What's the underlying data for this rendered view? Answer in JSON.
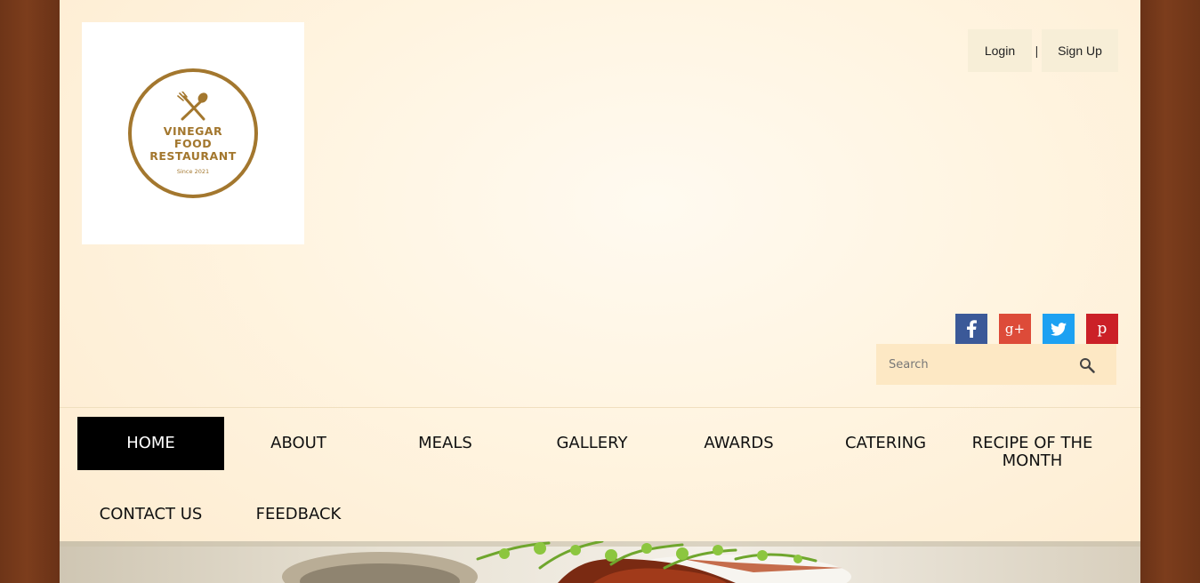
{
  "logo": {
    "line1": "VINEGAR",
    "line2": "FOOD",
    "line3": "RESTAURANT",
    "since": "Since 2021",
    "icon": "fork-spoon-icon",
    "color": "#a3772e"
  },
  "auth": {
    "login_label": "Login",
    "separator": "|",
    "signup_label": "Sign Up"
  },
  "social": [
    {
      "name": "facebook",
      "glyph": "f",
      "color": "#3b5998"
    },
    {
      "name": "google-plus",
      "glyph": "g+",
      "color": "#dd4b39"
    },
    {
      "name": "twitter",
      "glyph": "twitter-bird",
      "color": "#1da1f2"
    },
    {
      "name": "pinterest",
      "glyph": "p",
      "color": "#cb2027"
    }
  ],
  "search": {
    "placeholder": "Search",
    "icon": "search-icon"
  },
  "nav": {
    "items": [
      {
        "label": "HOME",
        "active": true
      },
      {
        "label": "ABOUT"
      },
      {
        "label": "MEALS"
      },
      {
        "label": "GALLERY"
      },
      {
        "label": "AWARDS"
      },
      {
        "label": "CATERING"
      },
      {
        "label": "RECIPE OF THE MONTH"
      },
      {
        "label": "CONTACT US"
      },
      {
        "label": "FEEDBACK"
      }
    ]
  },
  "colors": {
    "nav_active_bg": "#000000",
    "frame_wood": "#6a3217",
    "page_bg": "#fff4e0"
  }
}
